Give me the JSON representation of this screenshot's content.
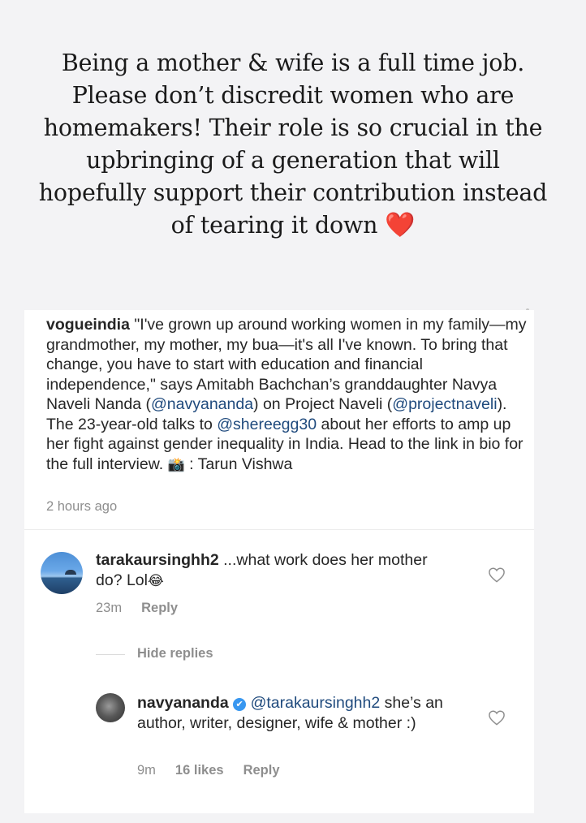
{
  "quote": {
    "lines": [
      "Being a mother & wife is a full time job.",
      "Please don’t discredit women who are",
      "homemakers! Their role is so crucial in the",
      "upbringing of a generation that will",
      "hopefully support their contribution instead",
      "of tearing it down"
    ],
    "heart": "❤️"
  },
  "post": {
    "username": "vogueindia",
    "caption_1": " \"I've grown up around working women in my family—my grandmother, my mother, my bua—it's all I've known. To bring that change, you have to start with education and financial independence,\" says Amitabh Bachchan’s granddaughter Navya Naveli Nanda (",
    "mention_1": "@navyananda",
    "caption_2": ") on Project Naveli (",
    "mention_2": "@projectnaveli",
    "caption_3": "). The 23-year-old talks to ",
    "mention_3": "@shereegg30",
    "caption_4": " about her efforts to amp up her fight against gender inequality in India. Head to the link in bio for the full interview. ",
    "camera_emoji": "📸",
    "caption_5": " : Tarun Vishwa",
    "time_ago": "2 hours ago"
  },
  "comment": {
    "username": "tarakaursinghh2",
    "text": " ...what work does her mother do? Lol",
    "emoji": "😂",
    "time": "23m",
    "reply_label": "Reply",
    "hide_replies_label": "Hide replies"
  },
  "reply": {
    "username": "navyananda",
    "verified_icon": "✔",
    "mention": "@tarakaursinghh2",
    "text": " she’s an author, writer, designer, wife & mother :)",
    "time": "9m",
    "likes": "16 likes",
    "reply_label": "Reply"
  },
  "colors": {
    "mention": "#1f4a7d",
    "verified": "#3897f0",
    "heart": "#d6202a",
    "secondary_text": "#8e8e8e"
  }
}
